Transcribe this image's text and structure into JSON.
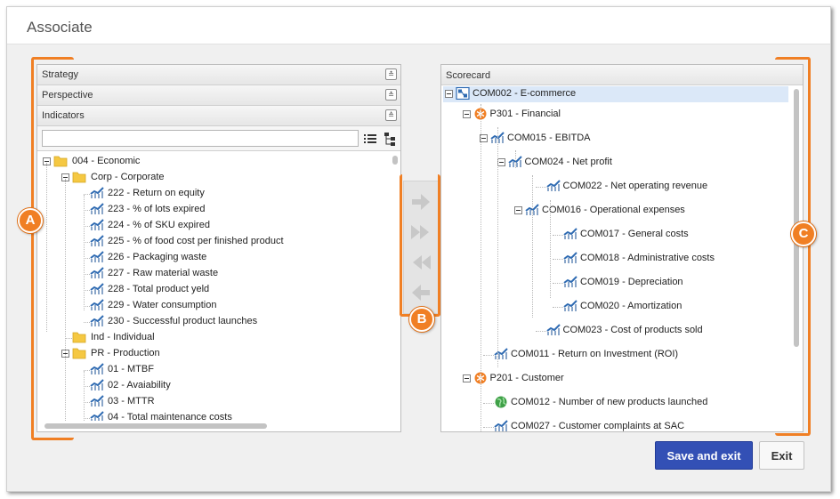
{
  "dialog": {
    "title": "Associate"
  },
  "left": {
    "accordion": [
      {
        "label": "Strategy",
        "state": "collapsed"
      },
      {
        "label": "Perspective",
        "state": "collapsed"
      },
      {
        "label": "Indicators",
        "state": "expanded"
      }
    ],
    "filter": {
      "value": "",
      "placeholder": ""
    },
    "tree": [
      {
        "label": "004 - Economic",
        "type": "folder",
        "depth": 0,
        "expander": true
      },
      {
        "label": "Corp - Corporate",
        "type": "folder",
        "depth": 1,
        "expander": true
      },
      {
        "label": "222 - Return on equity",
        "type": "indicator",
        "depth": 2
      },
      {
        "label": "223 - % of lots expired",
        "type": "indicator",
        "depth": 2
      },
      {
        "label": "224 - % of SKU expired",
        "type": "indicator",
        "depth": 2
      },
      {
        "label": "225 - % of food cost per finished product",
        "type": "indicator",
        "depth": 2
      },
      {
        "label": "226 - Packaging waste",
        "type": "indicator",
        "depth": 2
      },
      {
        "label": "227 - Raw material waste",
        "type": "indicator",
        "depth": 2
      },
      {
        "label": "228 - Total product yeld",
        "type": "indicator",
        "depth": 2
      },
      {
        "label": "229 - Water consumption",
        "type": "indicator",
        "depth": 2
      },
      {
        "label": "230 - Successful product launches",
        "type": "indicator",
        "depth": 2
      },
      {
        "label": "Ind - Individual",
        "type": "folder",
        "depth": 1,
        "expander": false
      },
      {
        "label": "PR - Production",
        "type": "folder",
        "depth": 1,
        "expander": true
      },
      {
        "label": "01 - MTBF",
        "type": "indicator",
        "depth": 2
      },
      {
        "label": "02 - Avaiability",
        "type": "indicator",
        "depth": 2
      },
      {
        "label": "03 - MTTR",
        "type": "indicator",
        "depth": 2
      },
      {
        "label": "04 - Total maintenance costs",
        "type": "indicator",
        "depth": 2
      }
    ]
  },
  "transfer": [
    {
      "name": "add-one-button",
      "glyph": "arrow-right"
    },
    {
      "name": "add-all-button",
      "glyph": "double-right"
    },
    {
      "name": "remove-all-button",
      "glyph": "double-left"
    },
    {
      "name": "remove-one-button",
      "glyph": "arrow-left"
    }
  ],
  "right": {
    "title": "Scorecard",
    "tree": [
      {
        "label": "COM002 - E-commerce",
        "type": "scorecard",
        "x": 0,
        "expander": true,
        "selected": true
      },
      {
        "label": "P301 - Financial",
        "type": "perspective",
        "x": 1,
        "expander": true
      },
      {
        "label": "COM015 - EBITDA",
        "type": "indicator",
        "x": 2,
        "expander": true
      },
      {
        "label": "COM024 - Net profit",
        "type": "indicator",
        "x": 3,
        "expander": true
      },
      {
        "label": "COM022 - Net operating revenue",
        "type": "indicator",
        "x": 5
      },
      {
        "label": "COM016 - Operational expenses",
        "type": "indicator",
        "x": 4,
        "expander": true
      },
      {
        "label": "COM017 - General costs",
        "type": "indicator",
        "x": 6
      },
      {
        "label": "COM018 - Administrative costs",
        "type": "indicator",
        "x": 6
      },
      {
        "label": "COM019 - Depreciation",
        "type": "indicator",
        "x": 6
      },
      {
        "label": "COM020 - Amortization",
        "type": "indicator",
        "x": 6
      },
      {
        "label": "COM023 - Cost of products sold",
        "type": "indicator",
        "x": 5
      },
      {
        "label": "COM011 - Return on Investment (ROI)",
        "type": "indicator",
        "x": 2
      },
      {
        "label": "P201 - Customer",
        "type": "perspective",
        "x": 1,
        "expander": true
      },
      {
        "label": "COM012 - Number of new products launched",
        "type": "globe",
        "x": 2
      },
      {
        "label": "COM027 - Customer complaints at SAC",
        "type": "indicator",
        "x": 2
      }
    ]
  },
  "callouts": {
    "a": "A",
    "b": "B",
    "c": "C"
  },
  "buttons": {
    "save": "Save and exit",
    "exit": "Exit"
  },
  "colors": {
    "accent": "#f07f24",
    "primary": "#3350b5",
    "folder": "#f5c842",
    "indicator": "#2f6bb2"
  }
}
